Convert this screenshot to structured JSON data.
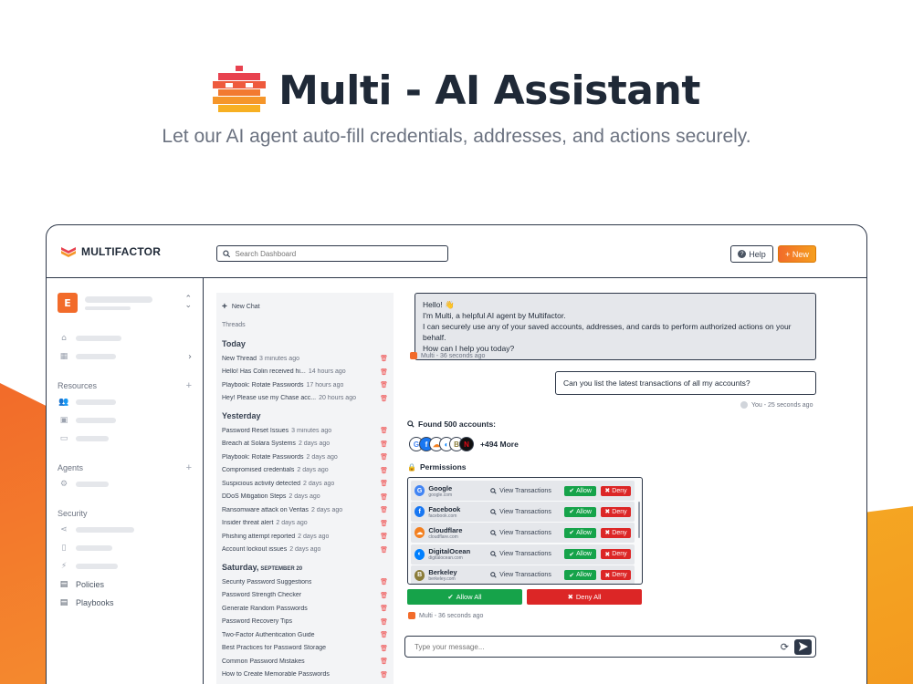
{
  "hero": {
    "title": "Multi - AI Assistant",
    "subtitle": "Let our AI agent auto-fill credentials, addresses, and actions securely."
  },
  "header": {
    "brand": "MULTIFACTOR",
    "search_placeholder": "Search Dashboard",
    "help_label": "Help",
    "new_label": "+ New"
  },
  "sidebar": {
    "org_initial": "E",
    "sections": {
      "resources": "Resources",
      "agents": "Agents",
      "security": "Security"
    },
    "policies": "Policies",
    "playbooks": "Playbooks"
  },
  "threads": {
    "new_chat": "New Chat",
    "label": "Threads",
    "groups": [
      {
        "head": "Today",
        "date": "",
        "items": [
          {
            "t": "New Thread",
            "ago": "3 minutes ago"
          },
          {
            "t": "Hello! Has Colin received hi...",
            "ago": "14 hours ago"
          },
          {
            "t": "Playbook: Rotate Passwords",
            "ago": "17 hours ago"
          },
          {
            "t": "Hey! Please use my Chase acc...",
            "ago": "20 hours ago"
          }
        ]
      },
      {
        "head": "Yesterday",
        "date": "",
        "items": [
          {
            "t": "Password Reset Issues",
            "ago": "3 minutes ago"
          },
          {
            "t": "Breach at Solara Systems",
            "ago": "2 days ago"
          },
          {
            "t": "Playbook: Rotate Passwords",
            "ago": "2 days ago"
          },
          {
            "t": "Compromised credentials",
            "ago": "2 days ago"
          },
          {
            "t": "Suspicious activity detected",
            "ago": "2 days ago"
          },
          {
            "t": "DDoS Mitigation Steps",
            "ago": "2 days ago"
          },
          {
            "t": "Ransomware attack on Veritas",
            "ago": "2 days ago"
          },
          {
            "t": "Insider threat alert",
            "ago": "2 days ago"
          },
          {
            "t": "Phishing attempt reported",
            "ago": "2 days ago"
          },
          {
            "t": "Account lockout issues",
            "ago": "2 days ago"
          }
        ]
      },
      {
        "head": "Saturday,",
        "date": "SEPTEMBER 20",
        "items": [
          {
            "t": "Security Password Suggestions",
            "ago": ""
          },
          {
            "t": "Password Strength Checker",
            "ago": ""
          },
          {
            "t": "Generate Random Passwords",
            "ago": ""
          },
          {
            "t": "Password Recovery Tips",
            "ago": ""
          },
          {
            "t": "Two-Factor Authentication Guide",
            "ago": ""
          },
          {
            "t": "Best Practices for Password Storage",
            "ago": ""
          },
          {
            "t": "Common Password Mistakes",
            "ago": ""
          },
          {
            "t": "How to Create Memorable Passwords",
            "ago": ""
          }
        ]
      }
    ]
  },
  "chat": {
    "ai_message": {
      "lines": [
        "Hello! 👋",
        "I'm Multi, a helpful AI agent by Multifactor.",
        "I can securely use any of your saved accounts, addresses, and cards to perform authorized actions on your behalf.",
        "How can I help you today?"
      ],
      "meta": "Multi - 36 seconds ago"
    },
    "user_message": {
      "text": "Can you list the latest transactions of all my accounts?",
      "meta": "You - 25 seconds ago"
    },
    "found_label": "Found 500 accounts:",
    "more_label": "+494 More",
    "permissions_label": "Permissions",
    "view_label": "View Transactions",
    "allow_label": "Allow",
    "deny_label": "Deny",
    "accounts": [
      {
        "name": "Google",
        "domain": "google.com",
        "color": "#4285f4",
        "glyph": "G"
      },
      {
        "name": "Facebook",
        "domain": "facebook.com",
        "color": "#1877f2",
        "glyph": "f"
      },
      {
        "name": "Cloudflare",
        "domain": "cloudflare.com",
        "color": "#f38020",
        "glyph": "☁"
      },
      {
        "name": "DigitalOcean",
        "domain": "digitalocean.com",
        "color": "#0080ff",
        "glyph": "◐"
      },
      {
        "name": "Berkeley",
        "domain": "berkeley.com",
        "color": "#8b7d3a",
        "glyph": "B"
      }
    ],
    "allow_all_label": "Allow All",
    "deny_all_label": "Deny All",
    "permissions_meta": "Multi - 36 seconds ago",
    "composer_placeholder": "Type your message..."
  },
  "colors": {
    "accent": "#f26b2a",
    "allow": "#16a34a",
    "deny": "#dc2626"
  }
}
